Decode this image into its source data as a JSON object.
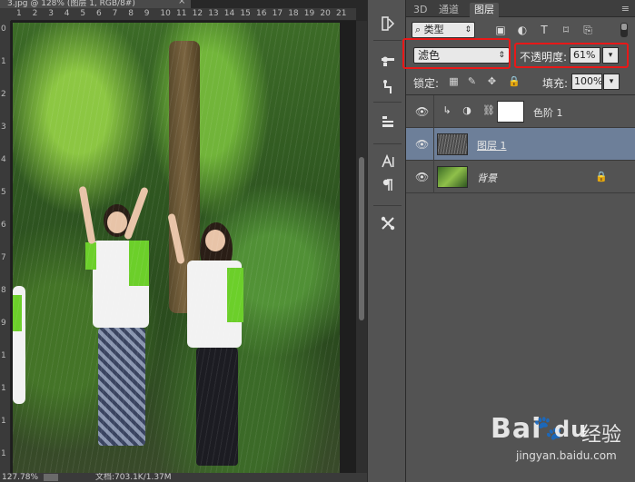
{
  "document": {
    "tab_title": "3.jpg @ 128% (图层 1, RGB/8#)",
    "close_glyph": "×"
  },
  "rulers": {
    "top_ticks": [
      "1",
      "2",
      "3",
      "4",
      "5",
      "6",
      "7",
      "8",
      "9",
      "10",
      "11",
      "12",
      "13",
      "14",
      "15",
      "16",
      "17",
      "18",
      "19",
      "20",
      "21"
    ],
    "left_ticks": [
      "0",
      "1",
      "2",
      "3",
      "4",
      "5",
      "6",
      "7",
      "8",
      "9",
      "1",
      "1",
      "1",
      "1"
    ]
  },
  "status": {
    "zoom": "127.78%",
    "doc_info": "文档:703.1K/1.37M"
  },
  "tools": [
    "history-brush-icon",
    "brush-settings-icon",
    "clone-source-icon",
    "paragraph-style-icon",
    "character-icon",
    "paragraph-icon",
    "tool-presets-icon"
  ],
  "panel": {
    "tabs": [
      {
        "label": "3D",
        "active": false
      },
      {
        "label": "通道",
        "active": false
      },
      {
        "label": "图层",
        "active": true
      }
    ],
    "menu_glyph": "≡",
    "filter": {
      "kind_label": "类型",
      "kind_caret": "⇕"
    },
    "blend": {
      "mode": "滤色",
      "caret": "⇕"
    },
    "opacity": {
      "label": "不透明度:",
      "value": "61%",
      "arrow": "▾"
    },
    "lock": {
      "label": "锁定:"
    },
    "fill": {
      "label": "填充:",
      "value": "100%",
      "arrow": "▾"
    },
    "layers": [
      {
        "name": "色阶 1",
        "type": "adjustment",
        "selected": false
      },
      {
        "name": "图层 1",
        "type": "pixel",
        "selected": true
      },
      {
        "name": "背景",
        "type": "background",
        "selected": false
      }
    ]
  },
  "watermark": {
    "brand": "Bai",
    "brand_tail": "du",
    "cn": "经验",
    "url": "jingyan.baidu.com"
  },
  "colors": {
    "panel_bg": "#535353",
    "selected_layer": "#6d7f99",
    "highlight_red": "#e81818"
  }
}
